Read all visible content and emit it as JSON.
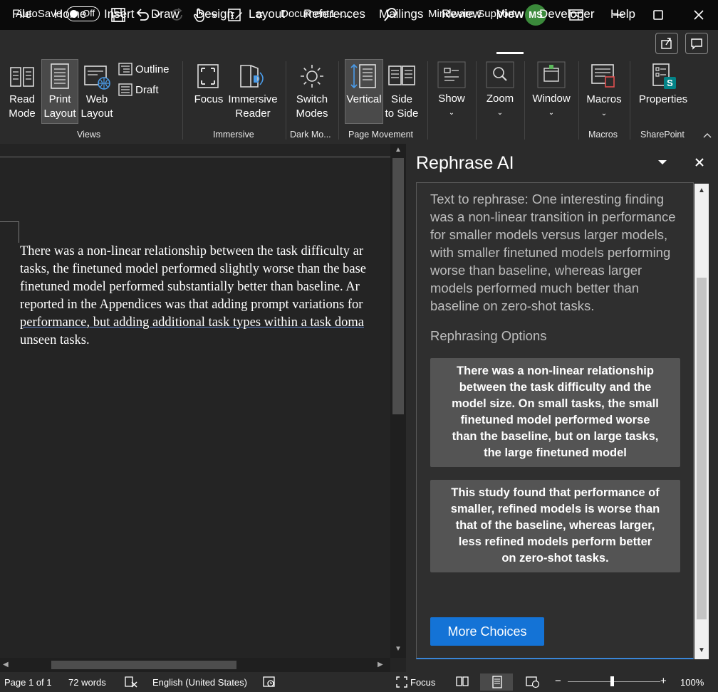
{
  "titlebar": {
    "autosave_label": "AutoSave",
    "autosave_state": "Off",
    "doc_title": "Document1  -...",
    "user_name": "Mindware Support",
    "user_initials": "MS"
  },
  "tabs": [
    "File",
    "Home",
    "Insert",
    "Draw",
    "Design",
    "Layout",
    "References",
    "Mailings",
    "Review",
    "View",
    "Developer",
    "Help"
  ],
  "ribbon": {
    "read_mode": [
      "Read",
      "Mode"
    ],
    "print_layout": [
      "Print",
      "Layout"
    ],
    "web_layout": [
      "Web",
      "Layout"
    ],
    "outline": "Outline",
    "draft": "Draft",
    "focus": "Focus",
    "immersive_reader": [
      "Immersive",
      "Reader"
    ],
    "switch_modes": [
      "Switch",
      "Modes"
    ],
    "vertical": "Vertical",
    "side_to_side": [
      "Side",
      "to Side"
    ],
    "show": "Show",
    "zoom": "Zoom",
    "window": "Window",
    "macros": "Macros",
    "properties": "Properties",
    "groups": {
      "views": "Views",
      "immersive": "Immersive",
      "dark_mode": "Dark Mo...",
      "page_movement": "Page Movement",
      "macros": "Macros",
      "sharepoint": "SharePoint"
    }
  },
  "document": {
    "lines": [
      "There was a non-linear relationship between the task difficulty ar",
      "tasks, the finetuned model performed slightly worse than the base",
      "finetuned model performed substantially better than baseline.  Ar",
      "reported in the Appendices was that adding prompt variations for",
      "performance, but adding additional task types within a task doma",
      "unseen tasks."
    ]
  },
  "pane": {
    "title": "Rephrase AI",
    "text_to_rephrase": [
      "Text to rephrase: One interesting finding",
      "was a non-linear transition in performance",
      "for smaller models versus larger models,",
      "with smaller finetuned models performing",
      "worse than baseline, whereas larger",
      "models performed much better than",
      "baseline on zero-shot tasks."
    ],
    "options_label": "Rephrasing Options",
    "option1": [
      "There was a non-linear relationship",
      "between the task difficulty and the",
      "model size. On small tasks, the small",
      "finetuned model performed worse",
      "than the baseline, but on large tasks,",
      "the large finetuned model"
    ],
    "option2": [
      "This study found that performance of",
      "smaller, refined models is worse than",
      "that of the baseline, whereas larger,",
      "less refined models perform better",
      "on zero-shot tasks."
    ],
    "more_choices": "More Choices"
  },
  "status": {
    "page": "Page 1 of 1",
    "words": "72 words",
    "language": "English (United States)",
    "focus": "Focus",
    "zoom": "100%",
    "zoom_minus": "−",
    "zoom_plus": "+"
  },
  "colors": {
    "accent": "#1473d6",
    "avatar": "#3b8a3b",
    "sharepoint": "#038387"
  }
}
